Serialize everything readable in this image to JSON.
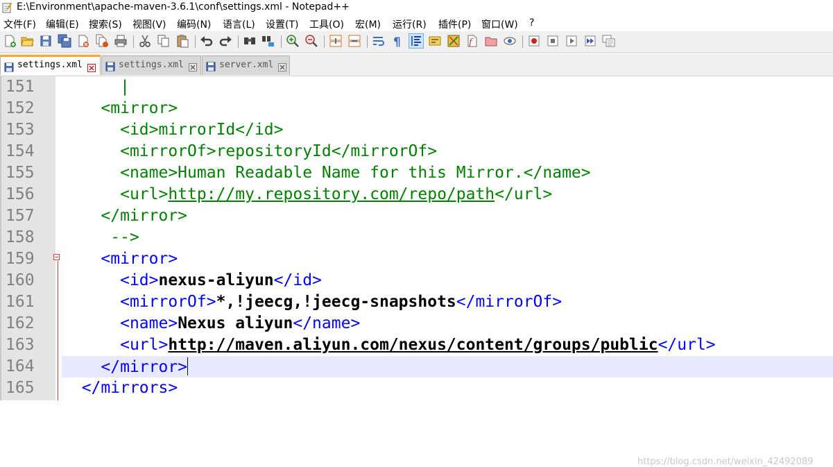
{
  "window": {
    "title": "E:\\Environment\\apache-maven-3.6.1\\conf\\settings.xml - Notepad++"
  },
  "menu": {
    "items": [
      "文件(F)",
      "编辑(E)",
      "搜索(S)",
      "视图(V)",
      "编码(N)",
      "语言(L)",
      "设置(T)",
      "工具(O)",
      "宏(M)",
      "运行(R)",
      "插件(P)",
      "窗口(W)",
      "?"
    ]
  },
  "toolbar": {
    "icons": [
      "new-file-icon",
      "open-file-icon",
      "save-icon",
      "save-all-icon",
      "close-icon",
      "close-all-icon",
      "print-icon",
      "cut-icon",
      "copy-icon",
      "paste-icon",
      "undo-icon",
      "redo-icon",
      "find-icon",
      "replace-icon",
      "zoom-in-icon",
      "zoom-out-icon",
      "sync-vertical-icon",
      "sync-horizontal-icon",
      "word-wrap-icon",
      "show-all-chars-icon",
      "indent-guide-icon",
      "user-language-icon",
      "doc-map-icon",
      "function-list-icon",
      "folder-workspace-icon",
      "monitoring-icon",
      "record-macro-icon",
      "stop-macro-icon",
      "play-macro-icon",
      "run-macro-multiple-icon",
      "save-macro-icon"
    ]
  },
  "tabs": [
    {
      "label": "settings.xml",
      "active": true
    },
    {
      "label": "settings.xml",
      "active": false
    },
    {
      "label": "server.xml",
      "active": false
    }
  ],
  "editor": {
    "lines": [
      {
        "num": "151",
        "indent": "      ",
        "segments": [
          {
            "t": "|",
            "c": "comment"
          }
        ]
      },
      {
        "num": "152",
        "indent": "    ",
        "segments": [
          {
            "t": "<mirror>",
            "c": "comment"
          }
        ]
      },
      {
        "num": "153",
        "indent": "      ",
        "segments": [
          {
            "t": "<id>mirrorId</id>",
            "c": "comment"
          }
        ]
      },
      {
        "num": "154",
        "indent": "      ",
        "segments": [
          {
            "t": "<mirrorOf>repositoryId</mirrorOf>",
            "c": "comment"
          }
        ]
      },
      {
        "num": "155",
        "indent": "      ",
        "segments": [
          {
            "t": "<name>Human Readable Name for this Mirror.</name>",
            "c": "comment"
          }
        ]
      },
      {
        "num": "156",
        "indent": "      ",
        "segments": [
          {
            "t": "<url>",
            "c": "comment"
          },
          {
            "t": "http://my.repository.com/repo/path",
            "c": "comment link"
          },
          {
            "t": "</url>",
            "c": "comment"
          }
        ]
      },
      {
        "num": "157",
        "indent": "    ",
        "segments": [
          {
            "t": "</mirror>",
            "c": "comment"
          }
        ]
      },
      {
        "num": "158",
        "indent": "     ",
        "segments": [
          {
            "t": "-->",
            "c": "comment"
          }
        ]
      },
      {
        "num": "159",
        "indent": "    ",
        "segments": [
          {
            "t": "<mirror>",
            "c": "tag"
          }
        ]
      },
      {
        "num": "160",
        "indent": "      ",
        "segments": [
          {
            "t": "<id>",
            "c": "tag"
          },
          {
            "t": "nexus-aliyun",
            "c": "text"
          },
          {
            "t": "</id>",
            "c": "tag"
          }
        ]
      },
      {
        "num": "161",
        "indent": "      ",
        "segments": [
          {
            "t": "<mirrorOf>",
            "c": "tag"
          },
          {
            "t": "*,!jeecg,!jeecg-snapshots",
            "c": "text"
          },
          {
            "t": "</mirrorOf>",
            "c": "tag"
          }
        ]
      },
      {
        "num": "162",
        "indent": "      ",
        "segments": [
          {
            "t": "<name>",
            "c": "tag"
          },
          {
            "t": "Nexus aliyun",
            "c": "text"
          },
          {
            "t": "</name>",
            "c": "tag"
          }
        ]
      },
      {
        "num": "163",
        "indent": "      ",
        "segments": [
          {
            "t": "<url>",
            "c": "tag"
          },
          {
            "t": "http://maven.aliyun.com/nexus/content/groups/public",
            "c": "text link"
          },
          {
            "t": "</url>",
            "c": "tag"
          }
        ]
      },
      {
        "num": "164",
        "indent": "    ",
        "segments": [
          {
            "t": "</mirror>",
            "c": "tag"
          }
        ],
        "current": true
      },
      {
        "num": "165",
        "indent": "  ",
        "segments": [
          {
            "t": "</mirrors>",
            "c": "tag"
          }
        ]
      }
    ]
  },
  "watermark": "https://blog.csdn.net/weixin_42492089"
}
